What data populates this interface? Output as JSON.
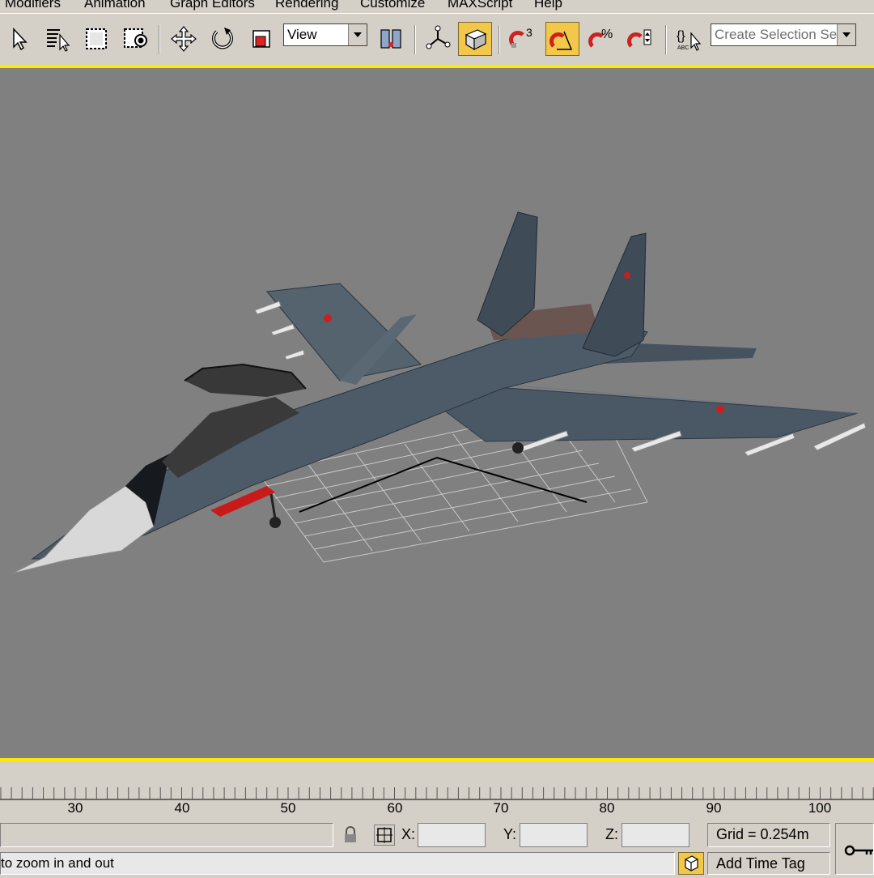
{
  "menu": {
    "items": [
      "Modifiers",
      "Animation",
      "Graph Editors",
      "Rendering",
      "Customize",
      "MAXScript",
      "Help"
    ]
  },
  "toolbar": {
    "reference_coord": "View",
    "selection_set_placeholder": "Create Selection Set",
    "snap_count": "3",
    "active_color": "#f3c84a"
  },
  "viewport": {
    "background": "#808080",
    "border_color": "#ffe800"
  },
  "timeline": {
    "ticks": [
      "30",
      "40",
      "50",
      "60",
      "70",
      "80",
      "90",
      "100"
    ]
  },
  "status": {
    "x_label": "X:",
    "y_label": "Y:",
    "z_label": "Z:",
    "x_value": "",
    "y_value": "",
    "z_value": "",
    "grid": "Grid = 0.254m",
    "prompt": "to zoom in and out",
    "add_time_tag": "Add Time Tag"
  }
}
